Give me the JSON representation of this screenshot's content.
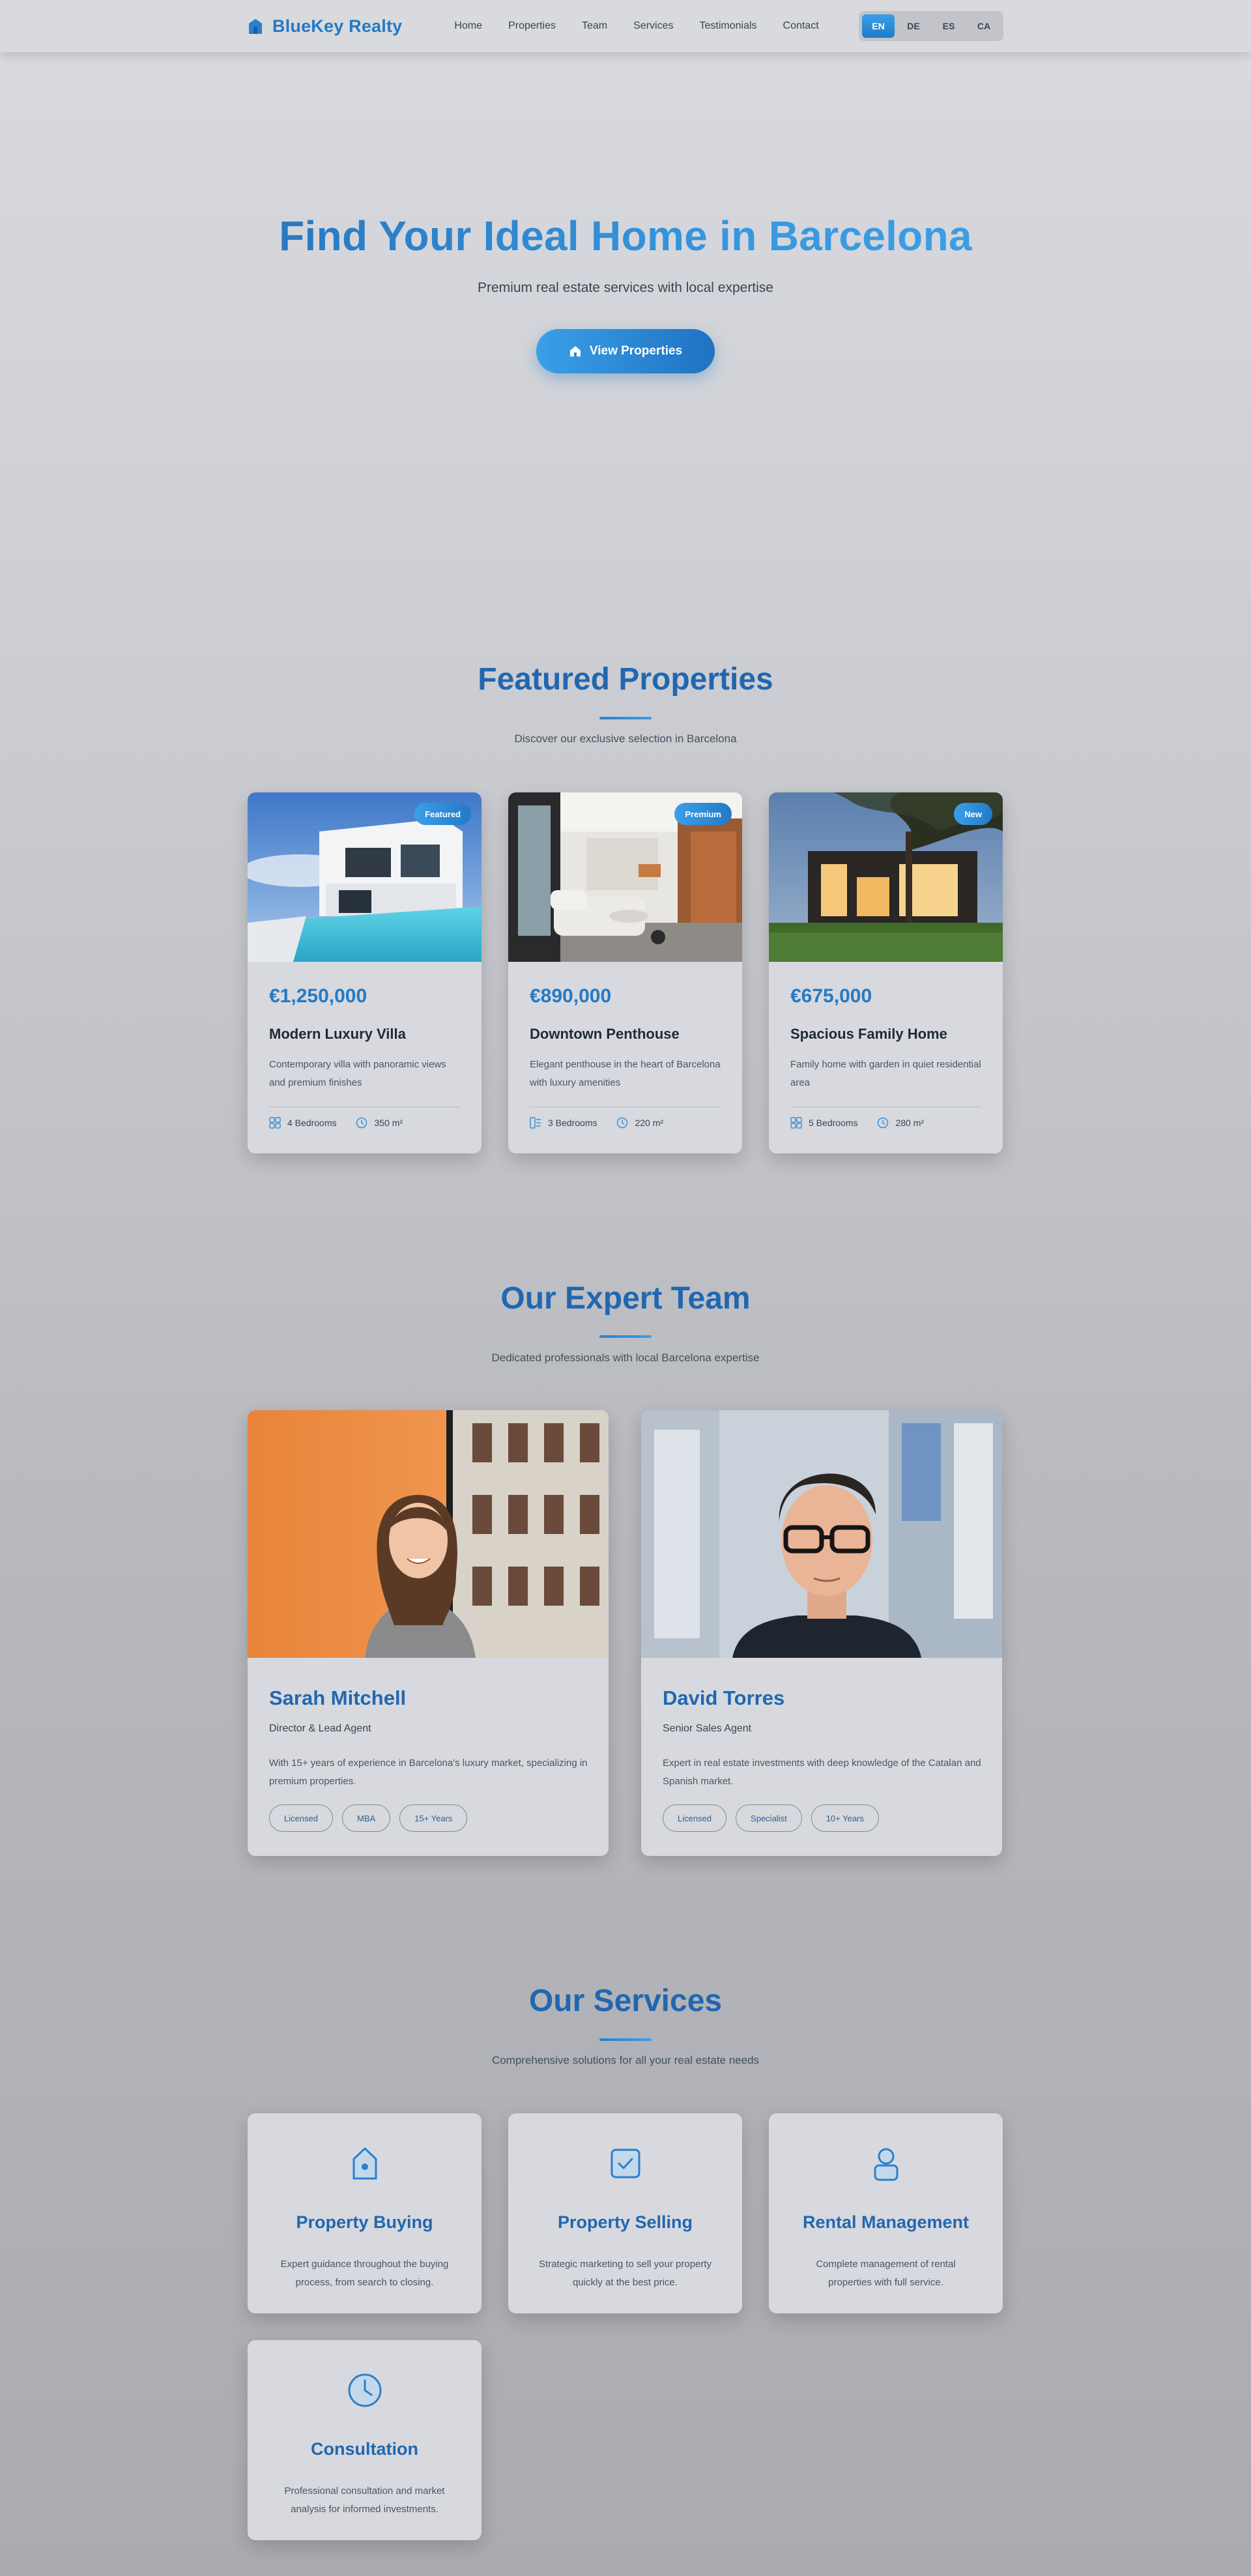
{
  "nav": {
    "brand": "BlueKey Realty",
    "links": [
      "Home",
      "Properties",
      "Team",
      "Services",
      "Testimonials",
      "Contact"
    ],
    "languages": [
      "EN",
      "DE",
      "ES",
      "CA"
    ],
    "active_language": "EN"
  },
  "hero": {
    "title": "Find Your Ideal Home in Barcelona",
    "subtitle": "Premium real estate services with local expertise",
    "cta": "View Properties"
  },
  "properties": {
    "title": "Featured Properties",
    "subtitle": "Discover our exclusive selection in Barcelona",
    "items": [
      {
        "badge": "Featured",
        "price": "€1,250,000",
        "name": "Modern Luxury Villa",
        "desc": "Contemporary villa with panoramic views and premium finishes",
        "bedrooms": "4 Bedrooms",
        "area": "350 m²"
      },
      {
        "badge": "Premium",
        "price": "€890,000",
        "name": "Downtown Penthouse",
        "desc": "Elegant penthouse in the heart of Barcelona with luxury amenities",
        "bedrooms": "3 Bedrooms",
        "area": "220 m²"
      },
      {
        "badge": "New",
        "price": "€675,000",
        "name": "Spacious Family Home",
        "desc": "Family home with garden in quiet residential area",
        "bedrooms": "5 Bedrooms",
        "area": "280 m²"
      }
    ]
  },
  "team": {
    "title": "Our Expert Team",
    "subtitle": "Dedicated professionals with local Barcelona expertise",
    "members": [
      {
        "name": "Sarah Mitchell",
        "role": "Director & Lead Agent",
        "bio": "With 15+ years of experience in Barcelona's luxury market, specializing in premium properties.",
        "tags": [
          "Licensed",
          "MBA",
          "15+ Years"
        ]
      },
      {
        "name": "David Torres",
        "role": "Senior Sales Agent",
        "bio": "Expert in real estate investments with deep knowledge of the Catalan and Spanish market.",
        "tags": [
          "Licensed",
          "Specialist",
          "10+ Years"
        ]
      }
    ]
  },
  "services": {
    "title": "Our Services",
    "subtitle": "Comprehensive solutions for all your real estate needs",
    "items": [
      {
        "icon": "house-icon",
        "title": "Property Buying",
        "desc": "Expert guidance throughout the buying process, from search to closing."
      },
      {
        "icon": "checkbox-icon",
        "title": "Property Selling",
        "desc": "Strategic marketing to sell your property quickly at the best price."
      },
      {
        "icon": "person-icon",
        "title": "Rental Management",
        "desc": "Complete management of rental properties with full service."
      },
      {
        "icon": "clock-icon",
        "title": "Consultation",
        "desc": "Professional consultation and market analysis for informed investments."
      }
    ]
  },
  "colors": {
    "accent": "#2579c4",
    "accent_light": "#3aa0e8",
    "heading": "#2167b0"
  }
}
